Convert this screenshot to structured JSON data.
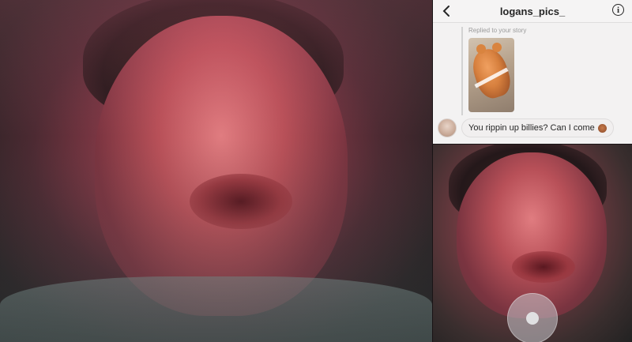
{
  "dm": {
    "username": "logans_pics_",
    "reply_label": "Replied to your story",
    "message": "You rippin up billies? Can I come",
    "back_icon": "chevron-left-icon",
    "info_icon": "info-icon",
    "info_glyph": "i"
  },
  "camera": {
    "record_icon": "record-button-icon"
  },
  "colors": {
    "panel_bg": "#f3f2f2",
    "text": "#262626",
    "meta": "#9a9a9a"
  }
}
